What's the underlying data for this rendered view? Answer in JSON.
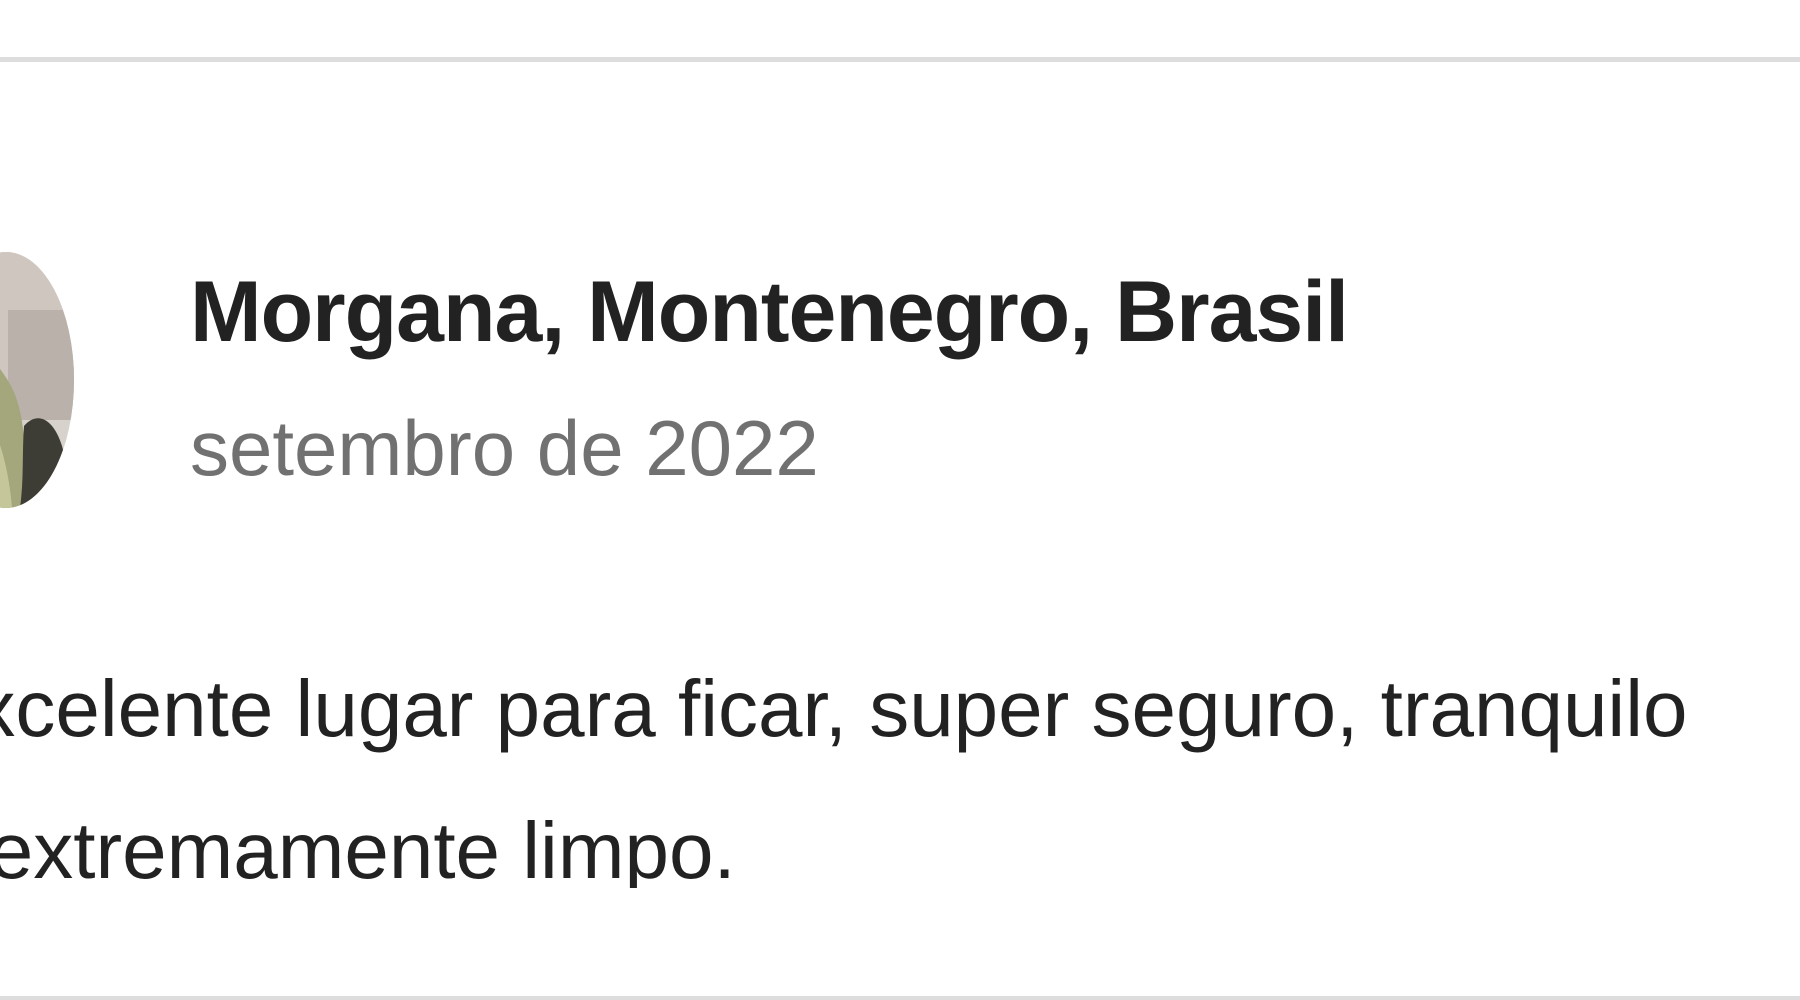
{
  "review": {
    "reviewer": {
      "name": "Morgana, Montenegro, Brasil",
      "avatar_icon": "user-photo-avatar"
    },
    "date": "setembro de 2022",
    "text": "Excelente lugar para ficar, super seguro, tranquilo\ne extremamente limpo."
  },
  "colors": {
    "primary_text": "#222222",
    "secondary_text": "#717171",
    "divider": "#dddddd",
    "background": "#ffffff"
  }
}
